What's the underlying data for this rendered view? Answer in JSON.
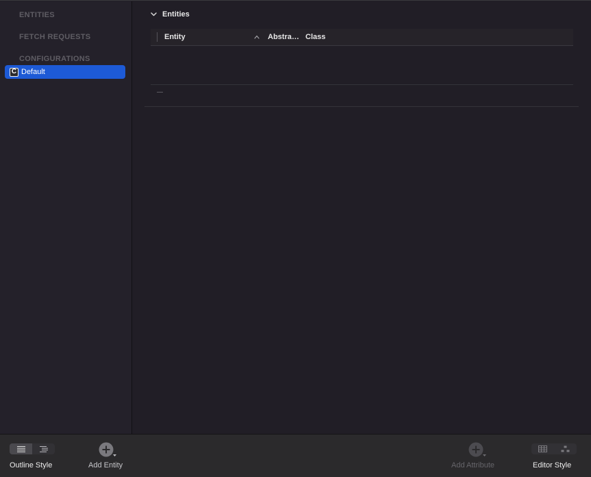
{
  "sidebar": {
    "sections": [
      {
        "label": "ENTITIES"
      },
      {
        "label": "FETCH REQUESTS"
      },
      {
        "label": "CONFIGURATIONS"
      }
    ],
    "selected_item": {
      "label": "Default",
      "icon_letter": "C",
      "icon": "configuration-icon"
    }
  },
  "main": {
    "section_title": "Entities",
    "columns": [
      "Entity",
      "Abstra…",
      "Class"
    ],
    "sort_column": "Entity",
    "rows": [],
    "remove_label": "—"
  },
  "toolbar": {
    "outline_style_label": "Outline Style",
    "add_entity_label": "Add Entity",
    "add_attribute_label": "Add Attribute",
    "editor_style_label": "Editor Style"
  },
  "colors": {
    "selection": "#1d5ad6",
    "background": "#211e26",
    "sidebar": "#24212a",
    "toolbar": "#2b2a2c",
    "muted_text": "#5f5d64"
  }
}
